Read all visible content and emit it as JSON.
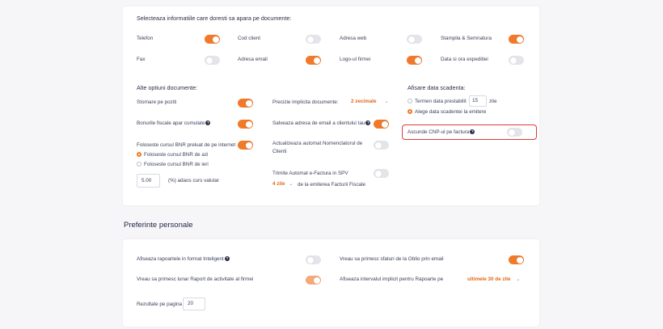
{
  "documents": {
    "heading": "Selecteaza informatiile care doresti sa apara pe documente:",
    "toggles": [
      {
        "label": "Telefon",
        "on": true
      },
      {
        "label": "Cod client",
        "on": false
      },
      {
        "label": "Adresa web",
        "on": false
      },
      {
        "label": "Stampila & Semnatura",
        "on": true
      },
      {
        "label": "Fax",
        "on": false
      },
      {
        "label": "Adresa email",
        "on": true
      },
      {
        "label": "Logo-ul firmei",
        "on": true
      },
      {
        "label": "Data si ora expeditiei",
        "on": false
      }
    ]
  },
  "other_options": {
    "heading": "Alte optiuni documente:",
    "stornare_label": "Stornare pe poziti",
    "bonurile_label": "Bonurile fiscale apar cumulate",
    "bnr_label": "Foloseste cursul BNR preluat de pe internet",
    "bnr_radio_1": "Foloseste cursul BNR de azi",
    "bnr_radio_2": "Foloseste cursul BNR de ieri",
    "rate_value": "5.00",
    "rate_label": "(%) adaos curs valutar",
    "precizie_label": "Precizie implicita documente:",
    "precizie_value": "2 zecimale",
    "salveaza_label": "Salveaza adresa de email a clientului tau",
    "actualizeaza_label_1": "Actualizeaza automat Nomenclatorul de",
    "actualizeaza_label_2": "Clienti",
    "trimite_label": "Trimite Automat e-Factura in SPV",
    "zile_value": "4 zile",
    "zile_suffix": "de la emiterea Facturii Fiscale"
  },
  "due_date": {
    "heading": "Afisare data scadenta:",
    "termen_label": "Termen data prestabilit",
    "termen_value": "15",
    "termen_unit": "zile",
    "alege_label": "Alege data scadentei la emitere",
    "cnp_label": "Ascunde CNP-ul pe factura"
  },
  "personal": {
    "title": "Preferinte personale",
    "rapoarte_label": "Afiseaza rapoartele in format Inteligent",
    "sfaturi_label": "Vreau sa primesc sfaturi de la Oblio prin email",
    "raport_label": "Vreau sa primesc lunar Raport de activitate al firmei",
    "interval_label": "Afiseaza intervalul implicit pentru Rapoarte pe",
    "interval_value": "ultimele 30 de zile",
    "rezultate_label": "Rezultate pe pagina",
    "rezultate_value": "20"
  },
  "colors": {
    "accent": "#f07a2a",
    "toggle_off": "#e4e5ea",
    "highlight": "#d93b3b"
  }
}
